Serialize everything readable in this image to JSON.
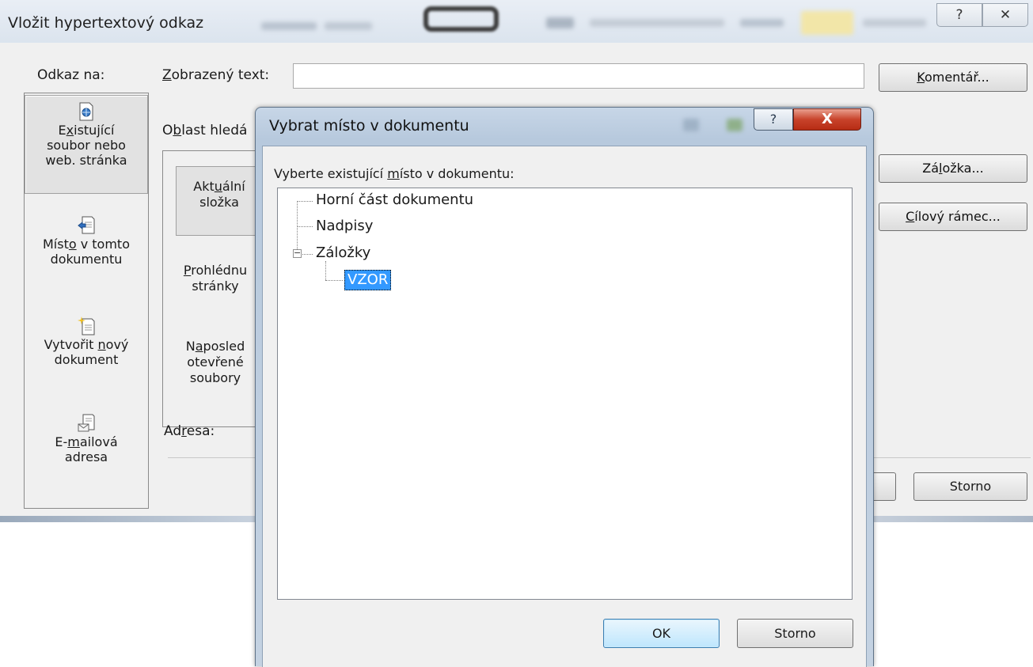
{
  "main_dialog": {
    "title": "Vložit hypertextový odkaz",
    "help_glyph": "?",
    "close_glyph": "✕",
    "link_to_label": "Odkaz na:",
    "link_bar": [
      {
        "line1_pre": "E",
        "line1_u": "x",
        "line1_post": "istující",
        "line2": "soubor nebo",
        "line3": "web. stránka",
        "icon": "globe-file-icon",
        "selected": true
      },
      {
        "line1_pre": "Míst",
        "line1_u": "o",
        "line1_post": " v tomto",
        "line2": "dokumentu",
        "icon": "document-place-icon"
      },
      {
        "line1_pre": "Vytvořit ",
        "line1_u": "n",
        "line1_post": "ový",
        "line2": "dokument",
        "icon": "new-document-icon"
      },
      {
        "line1_pre": "E-",
        "line1_u": "m",
        "line1_post": "ailová",
        "line2": "adresa",
        "icon": "email-icon"
      }
    ],
    "display_text": {
      "label_u": "Z",
      "label_rest": "obrazený text:",
      "value": ""
    },
    "comment_button": {
      "u": "K",
      "rest": "omentář..."
    },
    "bookmark_button": {
      "pre": "Zá",
      "u": "l",
      "rest": "ožka..."
    },
    "target_frame_button": {
      "u": "C",
      "rest": "ílový rámec..."
    },
    "search_area": {
      "pre": "O",
      "u": "b",
      "rest": "last hledá"
    },
    "current_folder": {
      "line1_pre": "Akt",
      "line1_u": "u",
      "line1_post": "ální",
      "line2": "složka"
    },
    "browsed_pages": {
      "line1_u": "P",
      "line1_post": "rohlédnu",
      "line2": "stránky"
    },
    "recent_files": {
      "line1_pre": "N",
      "line1_u": "a",
      "line1_post": "posled",
      "line2": "otevřené",
      "line3": "soubory"
    },
    "address": {
      "pre": "Ad",
      "u": "r",
      "rest": "esa:"
    },
    "cancel_label": "Storno"
  },
  "place_dialog": {
    "title": "Vybrat místo v dokumentu",
    "help_glyph": "?",
    "close_glyph": "X",
    "prompt": {
      "pre": "Vyberte existující ",
      "u": "m",
      "rest": "ísto v dokumentu:"
    },
    "tree": [
      {
        "label": "Horní část dokumentu",
        "level": 0
      },
      {
        "label": "Nadpisy",
        "level": 0
      },
      {
        "label": "Záložky",
        "level": 0,
        "expanded": true
      },
      {
        "label": "VZOR",
        "level": 1,
        "selected": true
      }
    ],
    "ok_label": "OK",
    "cancel_label": "Storno"
  },
  "colors": {
    "selection": "#3399ff",
    "close_button": "#c8432b",
    "dialog_frame": "#b7c9dd"
  }
}
